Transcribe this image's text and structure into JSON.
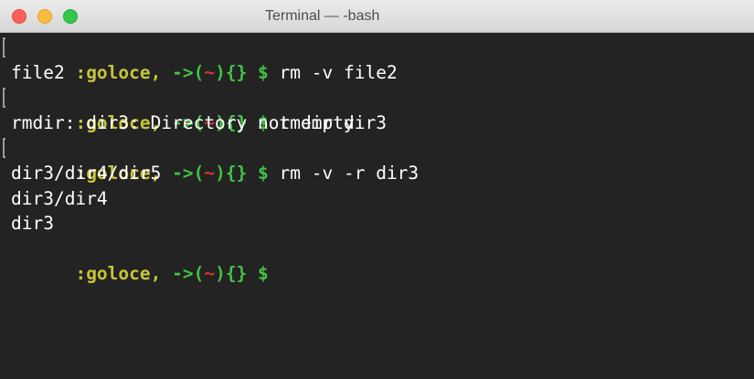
{
  "window": {
    "title": "Terminal — -bash",
    "controls": {
      "close_color": "#fc605c",
      "minimize_color": "#fdbc40",
      "zoom_color": "#34c84a"
    }
  },
  "prompt": {
    "user": ":goloce,",
    "arrow": " ->(",
    "tilde": "~",
    "rest": "){} $ "
  },
  "lines": [
    {
      "type": "prompt",
      "command": "rm -v file2"
    },
    {
      "type": "output",
      "text": "file2"
    },
    {
      "type": "prompt",
      "command": "rmdir dir3"
    },
    {
      "type": "output",
      "text": "rmdir: dir3: Directory not empty"
    },
    {
      "type": "prompt",
      "command": "rm -v -r dir3"
    },
    {
      "type": "output",
      "text": "dir3/dir4/dir5"
    },
    {
      "type": "output",
      "text": "dir3/dir4"
    },
    {
      "type": "output",
      "text": "dir3"
    },
    {
      "type": "prompt",
      "command": ""
    }
  ],
  "colors": {
    "background": "#232323",
    "prompt_user": "#c7c43a",
    "prompt_arrow": "#43c245",
    "prompt_tilde": "#d43a2c",
    "text": "#ffffff"
  }
}
